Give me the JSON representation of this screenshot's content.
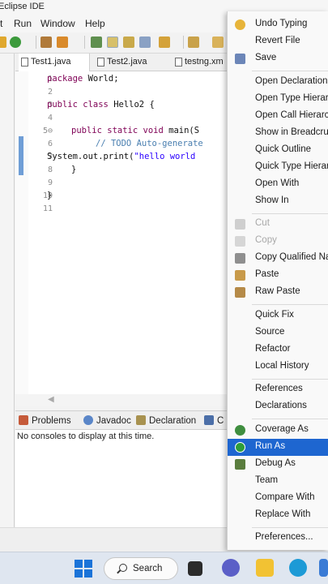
{
  "window": {
    "title": "Eclipse IDE"
  },
  "menubar": {
    "items": [
      "Run",
      "Window",
      "Help"
    ]
  },
  "editor_tabs": [
    "Test1.java",
    "Test2.java",
    "testng.xm"
  ],
  "editor": {
    "line_numbers": [
      "1",
      "2",
      "3",
      "4",
      "5⊖",
      "6",
      "7",
      "8",
      "9",
      "10",
      "11"
    ]
  },
  "code": {
    "package_kw": "package",
    "package_name": " World;",
    "public_kw": "public",
    "class_kw": " class",
    "class_name": " Hello2 {",
    "main_mods": "public static void",
    "main_sig": " main(S",
    "todo_comment": "// TODO Auto-generate",
    "print_stmt": "System.out.print(",
    "print_str": "\"hello world",
    "close_brace_inner": "}",
    "close_brace_outer": "}"
  },
  "bottom_tabs": [
    "Problems",
    "Javadoc",
    "Declaration",
    "C"
  ],
  "console": {
    "message": "No consoles to display at this time."
  },
  "context_menu": {
    "undo": "Undo Typing",
    "revert": "Revert File",
    "save": "Save",
    "open_declaration": "Open Declaration",
    "open_type_hierarchy": "Open Type Hierarc",
    "open_call_hierarchy": "Open Call Hierarch",
    "show_in_breadcrumb": "Show in Breadcrun",
    "quick_outline": "Quick Outline",
    "quick_type_hierarchy": "Quick Type Hierarc",
    "open_with": "Open With",
    "show_in": "Show In",
    "cut": "Cut",
    "copy": "Copy",
    "copy_qualified": "Copy Qualified Na",
    "paste": "Paste",
    "raw_paste": "Raw Paste",
    "quick_fix": "Quick Fix",
    "source": "Source",
    "refactor": "Refactor",
    "local_history": "Local History",
    "references": "References",
    "declarations": "Declarations",
    "coverage_as": "Coverage As",
    "run_as": "Run As",
    "debug_as": "Debug As",
    "team": "Team",
    "compare_with": "Compare With",
    "replace_with": "Replace With",
    "preferences": "Preferences..."
  },
  "taskbar": {
    "search_label": "Search"
  },
  "colors": {
    "highlight": "#1e66d0",
    "keyword": "#7f0055",
    "comment": "#4a7fb0",
    "string": "#2a00ff"
  }
}
